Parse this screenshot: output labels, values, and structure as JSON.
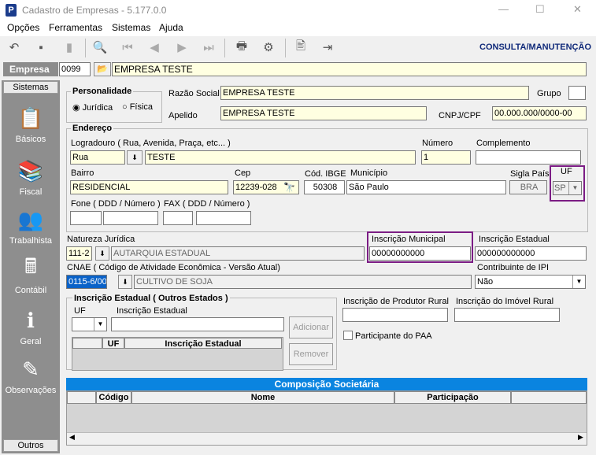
{
  "window": {
    "title": "Cadastro de Empresas - 5.177.0.0",
    "minimize": "—",
    "maximize": "☐",
    "close": "✕"
  },
  "menu": {
    "opcoes": "Opções",
    "ferramentas": "Ferramentas",
    "sistemas": "Sistemas",
    "ajuda": "Ajuda"
  },
  "toolbar": {
    "mode_label": "CONSULTA/MANUTENÇÃO"
  },
  "empresa": {
    "label": "Empresa",
    "code": "0099",
    "name": "EMPRESA TESTE"
  },
  "sidebar": {
    "top_tab": "Sistemas",
    "bottom_tab": "Outros",
    "items": [
      {
        "label": "Básicos",
        "icon": "basicos-icon"
      },
      {
        "label": "Fiscal",
        "icon": "fiscal-icon"
      },
      {
        "label": "Trabalhista",
        "icon": "trabalhista-icon"
      },
      {
        "label": "Contábil",
        "icon": "contabil-icon"
      },
      {
        "label": "Geral",
        "icon": "geral-icon"
      },
      {
        "label": "Observações",
        "icon": "observacoes-icon"
      }
    ]
  },
  "personalidade": {
    "title": "Personalidade",
    "juridica": "Jurídica",
    "fisica": "Física",
    "selected": "Jurídica"
  },
  "razao_social": {
    "label": "Razão Social",
    "value": "EMPRESA TESTE"
  },
  "grupo": {
    "label": "Grupo",
    "value": ""
  },
  "apelido": {
    "label": "Apelido",
    "value": "EMPRESA TESTE"
  },
  "cnpj": {
    "label": "CNPJ/CPF",
    "value": "00.000.000/0000-00"
  },
  "endereco": {
    "title": "Endereço",
    "logradouro_label": "Logradouro ( Rua, Avenida, Praça, etc... )",
    "tipo": "Rua",
    "logradouro": "TESTE",
    "numero_label": "Número",
    "numero": "1",
    "complemento_label": "Complemento",
    "complemento": "",
    "bairro_label": "Bairro",
    "bairro": "RESIDENCIAL",
    "cep_label": "Cep",
    "cep": "12239-028",
    "ibge_label": "Cód. IBGE",
    "ibge": "50308",
    "municipio_label": "Município",
    "municipio": "São Paulo",
    "pais_label": "Sigla País",
    "pais": "BRA",
    "uf_label": "UF",
    "uf": "SP",
    "fone_label": "Fone ( DDD / Número )",
    "fax_label": "FAX ( DDD / Número )"
  },
  "natureza": {
    "label": "Natureza Jurídica",
    "code": "111-2",
    "desc": "AUTARQUIA ESTADUAL"
  },
  "insc_municipal": {
    "label": "Inscrição Municipal",
    "value": "00000000000"
  },
  "insc_estadual": {
    "label": "Inscrição Estadual",
    "value": "000000000000"
  },
  "cnae": {
    "label": "CNAE ( Código de Atividade Econômica - Versão Atual)",
    "code": "0115-6/00",
    "desc": "CULTIVO DE SOJA"
  },
  "ipi": {
    "label": "Contribuinte de IPI",
    "value": "Não"
  },
  "ie_outros": {
    "title": "Inscrição Estadual ( Outros Estados )",
    "uf_label": "UF",
    "ie_label": "Inscrição Estadual",
    "add": "Adicionar",
    "remove": "Remover",
    "col_uf": "UF",
    "col_ie": "Inscrição Estadual"
  },
  "produtor_rural": {
    "label": "Inscrição de Produtor Rural",
    "value": ""
  },
  "imovel_rural": {
    "label": "Inscrição do Imóvel Rural",
    "value": ""
  },
  "paa": {
    "label": "Participante do PAA"
  },
  "composicao": {
    "title": "Composição Societária",
    "col_codigo": "Código",
    "col_nome": "Nome",
    "col_participacao": "Participação"
  },
  "colors": {
    "accent": "#0a84e0",
    "purple_highlight": "#7b1c84",
    "field_yellow": "#ffffe1"
  }
}
